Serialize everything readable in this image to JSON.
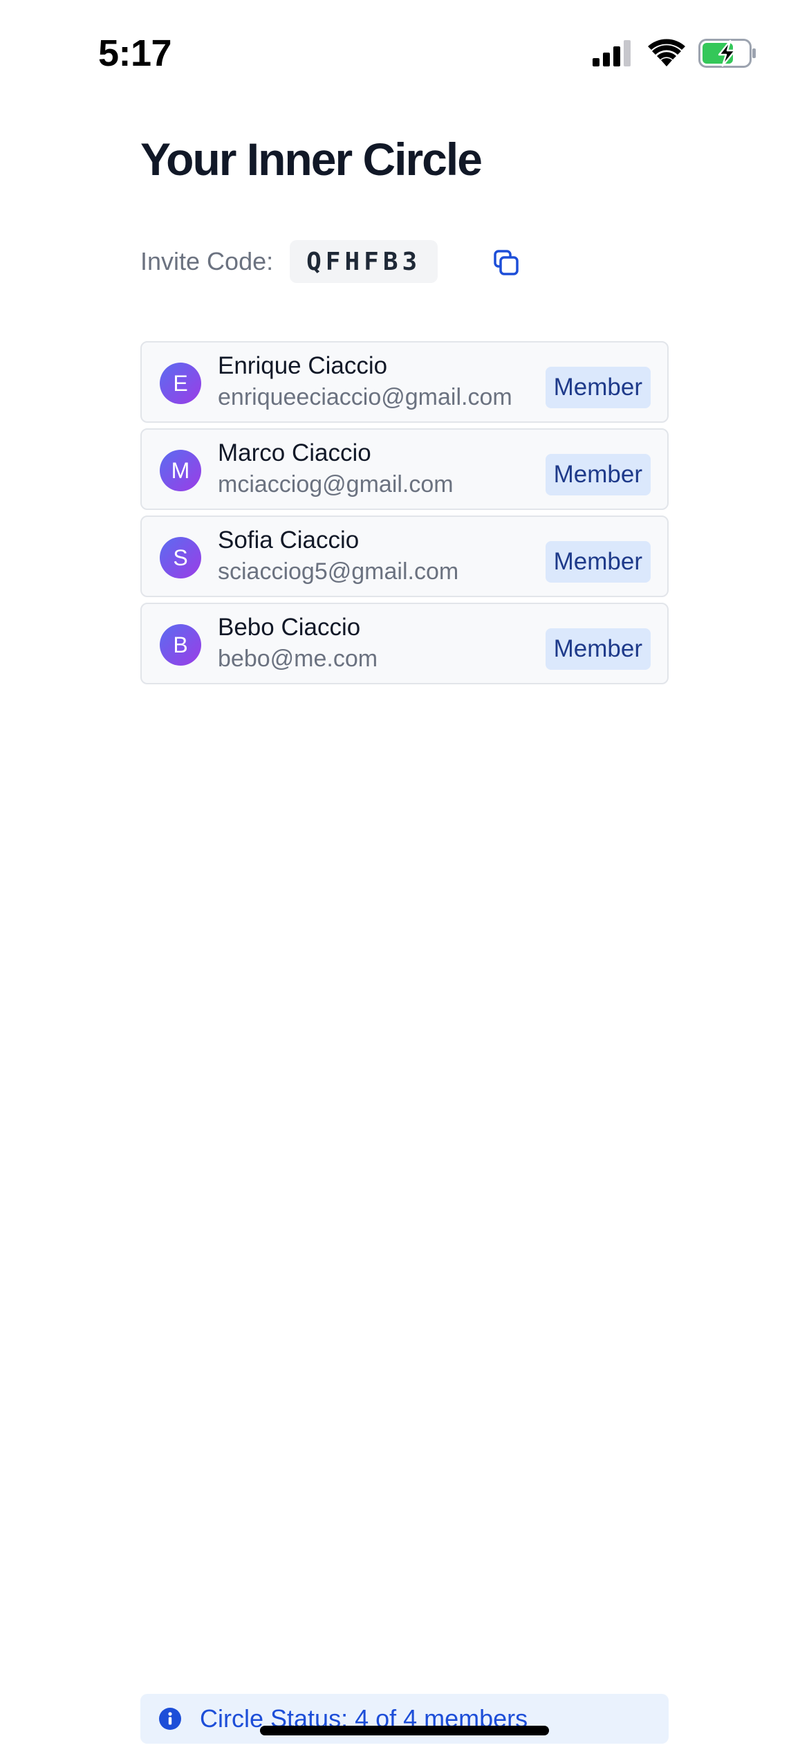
{
  "status_bar": {
    "time": "5:17",
    "icons": [
      "signal-icon",
      "wifi-icon",
      "battery-charging-icon"
    ]
  },
  "page": {
    "title": "Your Inner Circle"
  },
  "invite": {
    "label": "Invite Code:",
    "code": "QFHFB3",
    "copy_icon": "copy-icon"
  },
  "members": [
    {
      "initial": "E",
      "name": "Enrique Ciaccio",
      "email": "enriqueeciaccio@gmail.com",
      "role": "Member"
    },
    {
      "initial": "M",
      "name": "Marco Ciaccio",
      "email": "mciacciog@gmail.com",
      "role": "Member"
    },
    {
      "initial": "S",
      "name": "Sofia Ciaccio",
      "email": "sciacciog5@gmail.com",
      "role": "Member"
    },
    {
      "initial": "B",
      "name": "Bebo Ciaccio",
      "email": "bebo@me.com",
      "role": "Member"
    }
  ],
  "footer": {
    "status_text": "Circle Status: 4 of 4 members",
    "icon": "info-icon"
  },
  "colors": {
    "accent": "#1d4ed8",
    "badge_bg": "#dbe8fc",
    "badge_text": "#1e3a8a",
    "avatar_gradient_start": "#5b6cf0",
    "avatar_gradient_end": "#9b3de6",
    "battery_fill": "#34c759"
  }
}
